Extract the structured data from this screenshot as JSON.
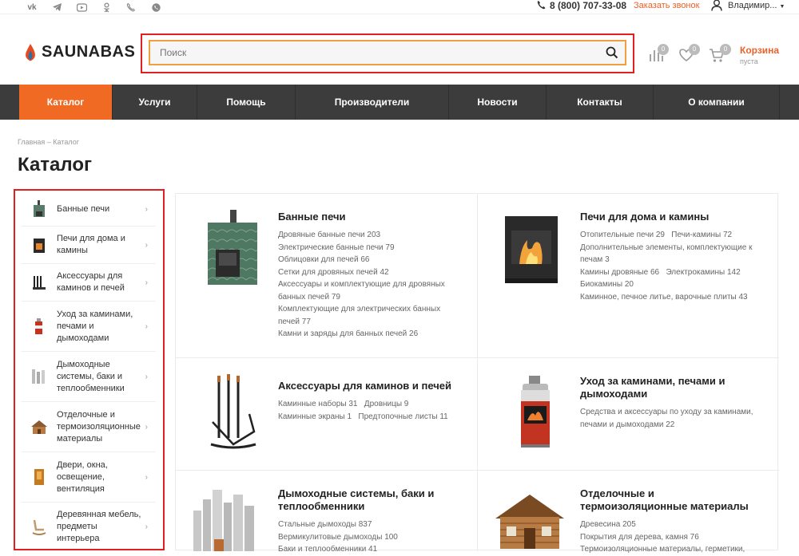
{
  "topbar": {
    "social": [
      "vk-icon",
      "telegram-icon",
      "youtube-icon",
      "odnoklassniki-icon",
      "viber-icon",
      "whatsapp-icon"
    ],
    "phone": "8 (800) 707-33-08",
    "callback": "Заказать звонок",
    "user": "Владимир..."
  },
  "header": {
    "logo": "SAUNABAS",
    "search_placeholder": "Поиск",
    "compare_count": "0",
    "favorites_count": "0",
    "cart_count": "0",
    "cart_title": "Корзина",
    "cart_status": "пуста"
  },
  "nav": [
    "Каталог",
    "Услуги",
    "Помощь",
    "Производители",
    "Новости",
    "Контакты",
    "О компании"
  ],
  "breadcrumb": "Главная – Каталог",
  "page_title": "Каталог",
  "sidebar": [
    "Банные печи",
    "Печи для дома и камины",
    "Аксессуары для каминов и печей",
    "Уход за каминами, печами и дымоходами",
    "Дымоходные системы, баки и теплообменники",
    "Отделочные и термоизоляционные материалы",
    "Двери, окна, освещение, вентиляция",
    "Деревянная мебель, предметы интерьера"
  ],
  "categories": [
    {
      "title": "Банные печи",
      "links": [
        "Дровяные банные печи 203",
        "Электрические банные печи 79",
        "Облицовки для печей 66",
        "Сетки для дровяных печей 42",
        "Аксессуары и комплектующие для дровяных банных печей 79",
        "Комплектующие для электрических банных печей 77",
        "Камни и заряды для банных печей 26"
      ]
    },
    {
      "title": "Печи для дома и камины",
      "links": [
        "Отопительные печи 29",
        "Печи-камины 72",
        "Дополнительные элементы, комплектующие к печам 3",
        "Камины дровяные 66",
        "Электрокамины 142",
        "Биокамины 20",
        "Каминное, печное литье, варочные плиты 43"
      ]
    },
    {
      "title": "Аксессуары для каминов и печей",
      "links": [
        "Каминные наборы 31",
        "Дровницы 9",
        "Каминные экраны 1",
        "Предтопочные листы 11"
      ]
    },
    {
      "title": "Уход за каминами, печами и дымоходами",
      "links": [
        "Средства и аксессуары по уходу за каминами, печами и дымоходами 22"
      ]
    },
    {
      "title": "Дымоходные системы, баки и теплообменники",
      "links": [
        "Стальные дымоходы 837",
        "Вермикулитовые дымоходы 100",
        "Баки и теплообменники 41"
      ]
    },
    {
      "title": "Отделочные и термоизоляционные материалы",
      "links": [
        "Древесина 205",
        "Покрытия для дерева, камня 76",
        "Термоизоляционные материалы, герметики,"
      ]
    }
  ]
}
